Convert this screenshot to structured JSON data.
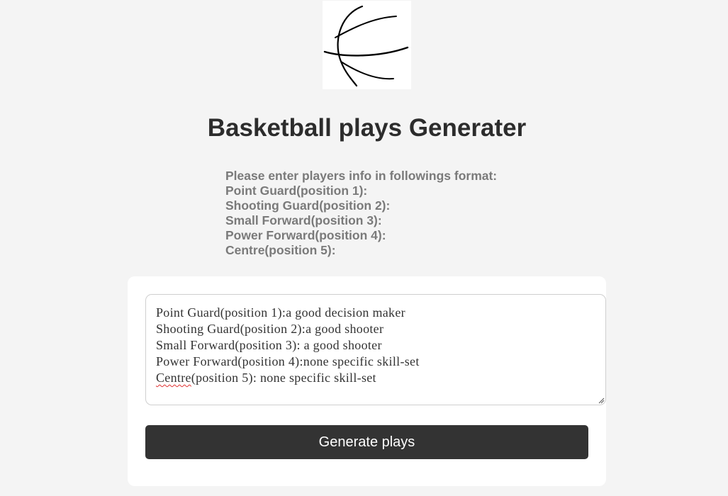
{
  "logo": {
    "icon": "basketball-icon"
  },
  "title": "Basketball plays Generater",
  "instructions": [
    "Please enter players info in followings format:",
    "Point Guard(position 1):",
    "Shooting Guard(position 2):",
    "Small Forward(position 3):",
    "Power Forward(position 4):",
    "Centre(position 5):"
  ],
  "textarea": {
    "lines": [
      "Point Guard(position 1):a good decision maker",
      "Shooting Guard(position 2):a good shooter",
      "Small Forward(position 3): a good shooter",
      "Power Forward(position 4):none specific skill-set"
    ],
    "last_line_word": "Centre",
    "last_line_rest": "(position 5): none specific skill-set"
  },
  "button": {
    "label": "Generate plays"
  },
  "colors": {
    "background": "#f4f4f4",
    "button": "#333333",
    "title": "#2c2c2c",
    "instructions": "#7a7a7a"
  }
}
